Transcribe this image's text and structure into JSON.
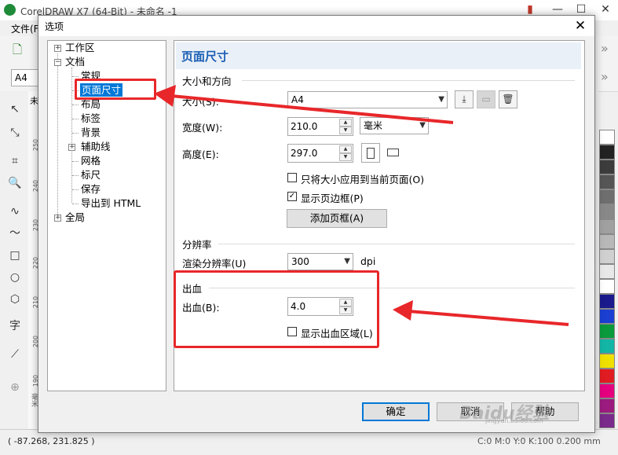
{
  "app": {
    "title": "CorelDRAW X7 (64-Bit) - 未命名 -1",
    "menu_file": "文件(F)",
    "page_size_box": "A4",
    "doc_tab": "未",
    "status_coords": "( -87.268, 231.825 )",
    "status_info": "C:0 M:0 Y:0 K:100 0.200 mm",
    "ruler_numbers": [
      "250",
      "240",
      "230",
      "220",
      "210",
      "200",
      "190"
    ],
    "ruler_unit": "毫米",
    "palette_colors": [
      "#ffffff",
      "#222222",
      "#3c3c3c",
      "#555555",
      "#6e6e6e",
      "#888888",
      "#a0a0a0",
      "#b8b8b8",
      "#d0d0d0",
      "#e8e8e8",
      "#ffffff",
      "#1a1a8c",
      "#1a3fd1",
      "#0a9a3c",
      "#13b5a6",
      "#f0e000",
      "#e11b22",
      "#e4007f",
      "#9b1b7e",
      "#7a2a8a"
    ]
  },
  "dialog": {
    "title": "选项",
    "close_glyph": "✕",
    "tree": {
      "workspace": "工作区",
      "document": "文档",
      "general": "常规",
      "page_size": "页面尺寸",
      "layout": "布局",
      "labels": "标签",
      "background": "背景",
      "guidelines": "辅助线",
      "grid": "网格",
      "rulers": "标尺",
      "save": "保存",
      "export_html": "导出到 HTML",
      "global": "全局"
    },
    "panel_title": "页面尺寸",
    "size_orientation": {
      "section": "大小和方向",
      "size_label": "大小(S):",
      "size_value": "A4",
      "width_label": "宽度(W):",
      "width_value": "210.0",
      "unit_value": "毫米",
      "height_label": "高度(E):",
      "height_value": "297.0",
      "apply_current_only_label": "只将大小应用到当前页面(O)",
      "apply_current_only_checked": false,
      "show_page_border_label": "显示页边框(P)",
      "show_page_border_checked": true,
      "add_page_frame_label": "添加页框(A)"
    },
    "resolution": {
      "section": "分辨率",
      "render_label": "渲染分辨率(U)",
      "render_value": "300",
      "render_unit": "dpi"
    },
    "bleed": {
      "section": "出血",
      "bleed_label": "出血(B):",
      "bleed_value": "4.0",
      "show_bleed_label": "显示出血区域(L)",
      "show_bleed_checked": false
    },
    "buttons": {
      "ok": "确定",
      "cancel": "取消",
      "help": "帮助"
    }
  },
  "annotations": {
    "highlight_color": "#e8272a"
  },
  "watermark": {
    "text": "Baidu经验",
    "sub": "jingyan.baidu.com"
  }
}
